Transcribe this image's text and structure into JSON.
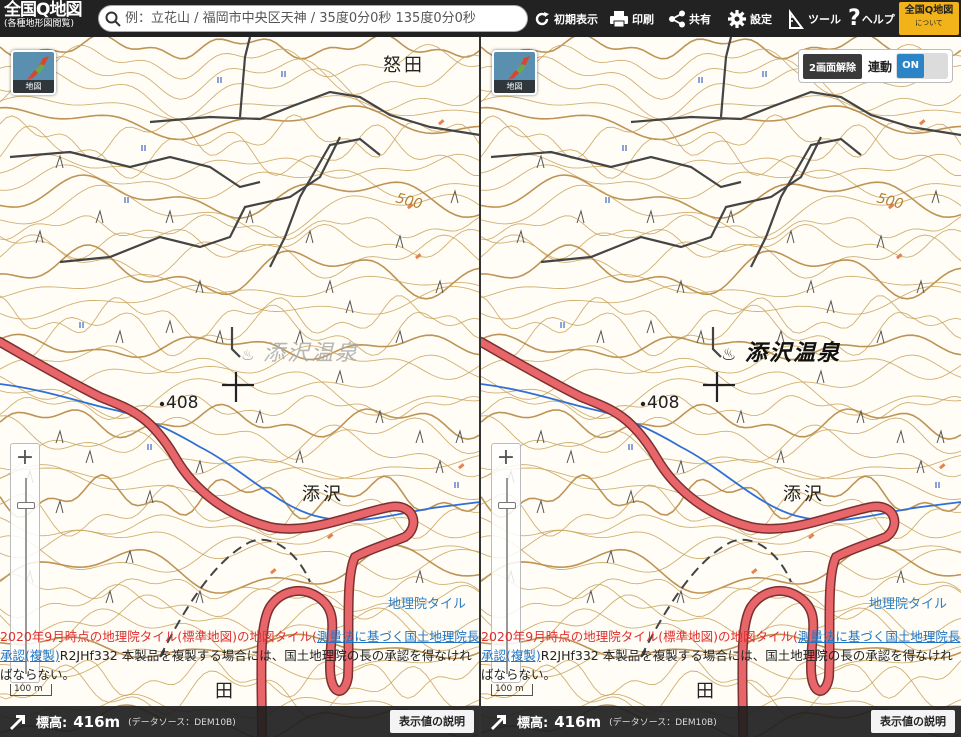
{
  "toolbar": {
    "logo_title": "全国Q地図",
    "logo_subtitle": "(各種地形図閲覧)",
    "search_placeholder": "例：立花山 / 福岡市中央区天神 / 35度0分0秒 135度0分0秒",
    "buttons": {
      "reset": "初期表示",
      "print": "印刷",
      "share": "共有",
      "settings": "設定",
      "tools": "ツール",
      "help": "ヘルプ"
    },
    "about_title": "全国Q地図",
    "about_sub": "について"
  },
  "map": {
    "layer_button_label": "地図",
    "zoom_in": "+",
    "scale_label": "100 m",
    "place_names": {
      "nuta": "怒田",
      "onsen": "添沢温泉",
      "onsen_symbol": "♨",
      "soesawa": "添沢",
      "spot_height": "408",
      "contour_label": "500",
      "bottom_kanji": "田"
    },
    "tile_label": "地理院タイル",
    "attribution": {
      "part1": "2020年9月時点の地理院タイル(標準地図)",
      "part2": "の地図タイル(",
      "part3": "測量法に基づく国土地理院長承認(複製)",
      "part4": "R2JHf332 本製品を複製する場合には、国土地理院の長の承認を得なければならない。"
    },
    "status": {
      "elevation_label": "標高:",
      "elevation_value": "416m",
      "source": "(データソース：DEM10B)",
      "explain_button": "表示値の説明"
    },
    "split": {
      "exit_button": "2画面解除",
      "link_label": "連動",
      "toggle_state": "ON"
    }
  },
  "colors": {
    "contour": "#c9a25a",
    "contour_index": "#b3813a",
    "road_main": "#e8666a",
    "river": "#2f6fd6",
    "boundary": "#444444",
    "toolbar_bg": "#222222",
    "accent": "#f2b21a",
    "toggle_on": "#2a84c6"
  }
}
